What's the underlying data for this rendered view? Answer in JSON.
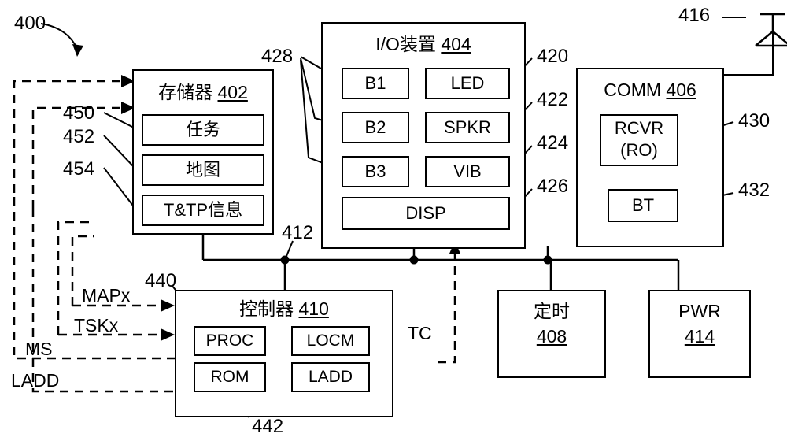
{
  "figure": {
    "ref_400": "400",
    "blocks": {
      "memory": {
        "title": "存储器",
        "ref": "402"
      },
      "io": {
        "title": "I/O装置",
        "ref": "404"
      },
      "comm": {
        "title": "COMM",
        "ref": "406"
      },
      "timer": {
        "title": "定时",
        "ref": "408"
      },
      "controller": {
        "title": "控制器",
        "ref": "410"
      },
      "pwr": {
        "title": "PWR",
        "ref": "414"
      }
    },
    "memory_items": [
      {
        "label": "任务",
        "ref": "450"
      },
      {
        "label": "地图",
        "ref": "452"
      },
      {
        "label": "T&TP信息",
        "ref": "454"
      }
    ],
    "io_items": [
      {
        "label": "B1"
      },
      {
        "label": "B2"
      },
      {
        "label": "B3"
      },
      {
        "label": "LED",
        "ref": "420"
      },
      {
        "label": "SPKR",
        "ref": "422"
      },
      {
        "label": "VIB",
        "ref": "424"
      },
      {
        "label": "DISP",
        "ref": "426"
      }
    ],
    "io_button_group_ref": "428",
    "comm_items": [
      {
        "label": "RCVR",
        "label2": "(RO)",
        "ref": "430"
      },
      {
        "label": "BT",
        "ref": "432"
      }
    ],
    "controller_items": [
      {
        "label": "PROC",
        "ref": "440"
      },
      {
        "label": "LOCM"
      },
      {
        "label": "ROM",
        "ref": "442"
      },
      {
        "label": "LADD"
      }
    ],
    "antenna_ref": "416",
    "bus_ref": "412",
    "signals": [
      {
        "label": "MAPx"
      },
      {
        "label": "TSKx"
      },
      {
        "label": "MS"
      },
      {
        "label": "LADD"
      },
      {
        "label": "TC"
      }
    ]
  }
}
